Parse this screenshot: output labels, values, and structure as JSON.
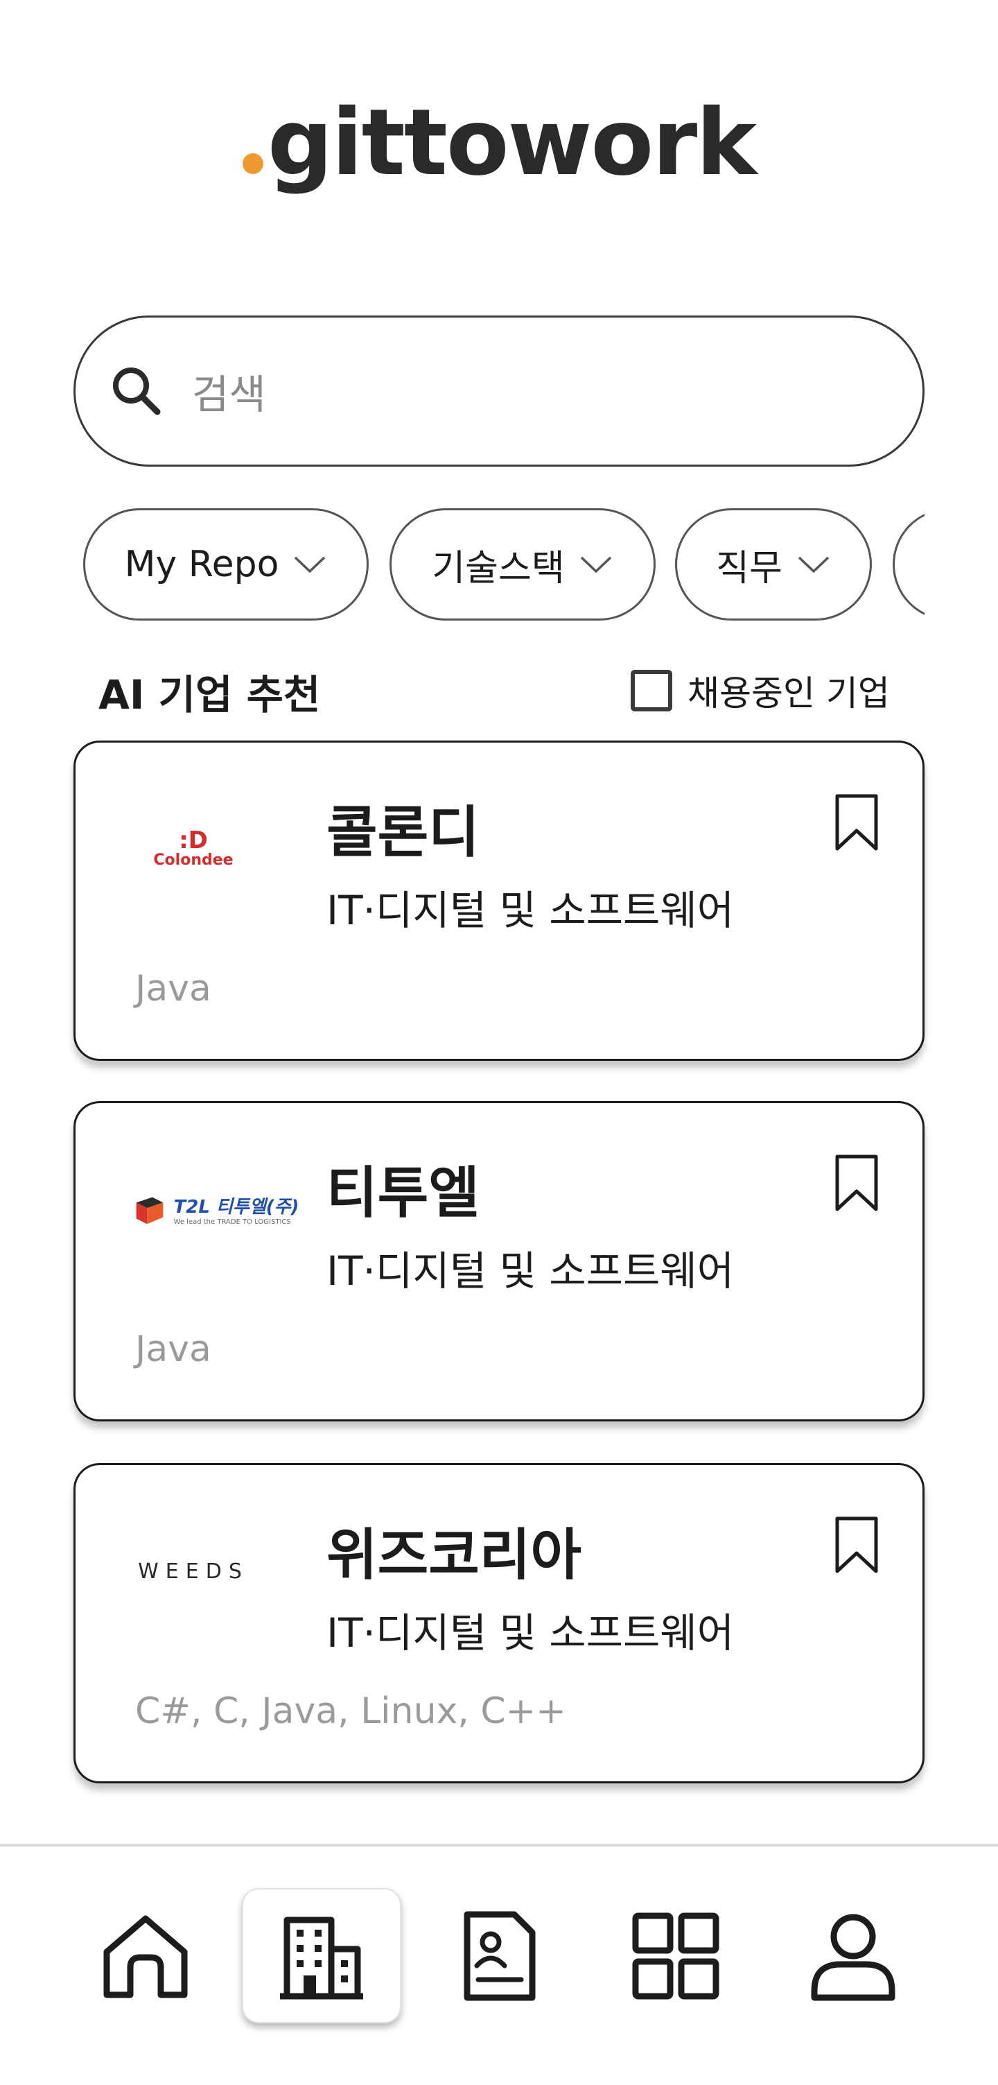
{
  "brand": {
    "dot_color": "#ee9a33",
    "name": "gittowork"
  },
  "search": {
    "placeholder": "검색",
    "icon": "search-icon"
  },
  "filters": [
    {
      "label": "My Repo",
      "icon": "chevron-down-icon"
    },
    {
      "label": "기술스택",
      "icon": "chevron-down-icon"
    },
    {
      "label": "직무",
      "icon": "chevron-down-icon"
    },
    {
      "label": ""
    }
  ],
  "section": {
    "title": "AI 기업 추천",
    "hiring_filter_label": "채용중인 기업",
    "hiring_filter_checked": false
  },
  "companies": [
    {
      "name": "콜론디",
      "category": "IT·디지털 및 소프트웨어",
      "stack": "Java",
      "logo_text": ":D",
      "logo_sub": "Colondee",
      "bookmarked": false
    },
    {
      "name": "티투엘",
      "category": "IT·디지털 및 소프트웨어",
      "stack": "Java",
      "logo_text": "T2L 티투엘(주)",
      "logo_sub": "We lead the TRADE TO LOGISTICS",
      "bookmarked": false
    },
    {
      "name": "위즈코리아",
      "category": "IT·디지털 및 소프트웨어",
      "stack": "C#, C, Java, Linux, C++",
      "logo_text": "WEEDS",
      "bookmarked": false
    }
  ],
  "bottom_nav": [
    {
      "icon": "home-icon",
      "active": false
    },
    {
      "icon": "building-icon",
      "active": true
    },
    {
      "icon": "resume-icon",
      "active": false
    },
    {
      "icon": "grid-icon",
      "active": false
    },
    {
      "icon": "user-icon",
      "active": false
    }
  ],
  "colors": {
    "accent": "#ee9a33",
    "border": "#1c1c1c",
    "muted_text": "#9a9a9a",
    "colondee_red": "#d42b2b",
    "t2l_blue": "#1f4fa8"
  }
}
